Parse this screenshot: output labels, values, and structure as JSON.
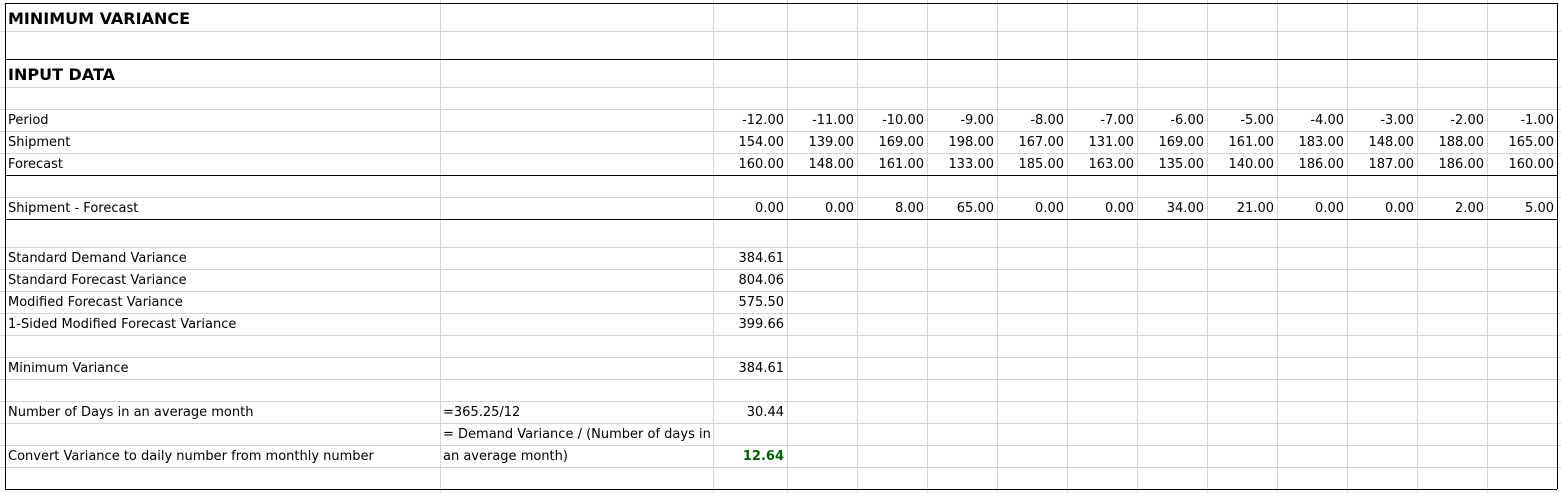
{
  "sheet": {
    "title": "MINIMUM VARIANCE",
    "section_title": "INPUT DATA",
    "rows": {
      "period": {
        "label": "Period",
        "values": [
          "-12.00",
          "-11.00",
          "-10.00",
          "-9.00",
          "-8.00",
          "-7.00",
          "-6.00",
          "-5.00",
          "-4.00",
          "-3.00",
          "-2.00",
          "-1.00"
        ]
      },
      "shipment": {
        "label": "Shipment",
        "values": [
          "154.00",
          "139.00",
          "169.00",
          "198.00",
          "167.00",
          "131.00",
          "169.00",
          "161.00",
          "183.00",
          "148.00",
          "188.00",
          "165.00"
        ]
      },
      "forecast": {
        "label": "Forecast",
        "values": [
          "160.00",
          "148.00",
          "161.00",
          "133.00",
          "185.00",
          "163.00",
          "135.00",
          "140.00",
          "186.00",
          "187.00",
          "186.00",
          "160.00"
        ]
      },
      "diff": {
        "label": "Shipment - Forecast",
        "values": [
          "0.00",
          "0.00",
          "8.00",
          "65.00",
          "0.00",
          "0.00",
          "34.00",
          "21.00",
          "0.00",
          "0.00",
          "2.00",
          "5.00"
        ]
      }
    },
    "stats": {
      "std_demand_variance": {
        "label": "Standard Demand Variance",
        "value": "384.61"
      },
      "std_forecast_variance": {
        "label": "Standard Forecast Variance",
        "value": "804.06"
      },
      "mod_forecast_variance": {
        "label": "Modified Forecast Variance",
        "value": "575.50"
      },
      "one_sided_mod_forecast_variance": {
        "label": "1-Sided Modified Forecast Variance",
        "value": "399.66"
      },
      "minimum_variance": {
        "label": "Minimum Variance",
        "value": "384.61"
      },
      "days_in_month": {
        "label": "Number of Days in an average month",
        "formula": "=365.25/12",
        "value": "30.44"
      },
      "daily_variance": {
        "label": "Convert Variance to daily number from monthly number",
        "formula_line1": "= Demand Variance / (Number of days in",
        "formula_line2": "an average month)",
        "value": "12.64"
      }
    },
    "colors": {
      "result_green": "#006100",
      "gridline": "#d4d4d4"
    }
  }
}
